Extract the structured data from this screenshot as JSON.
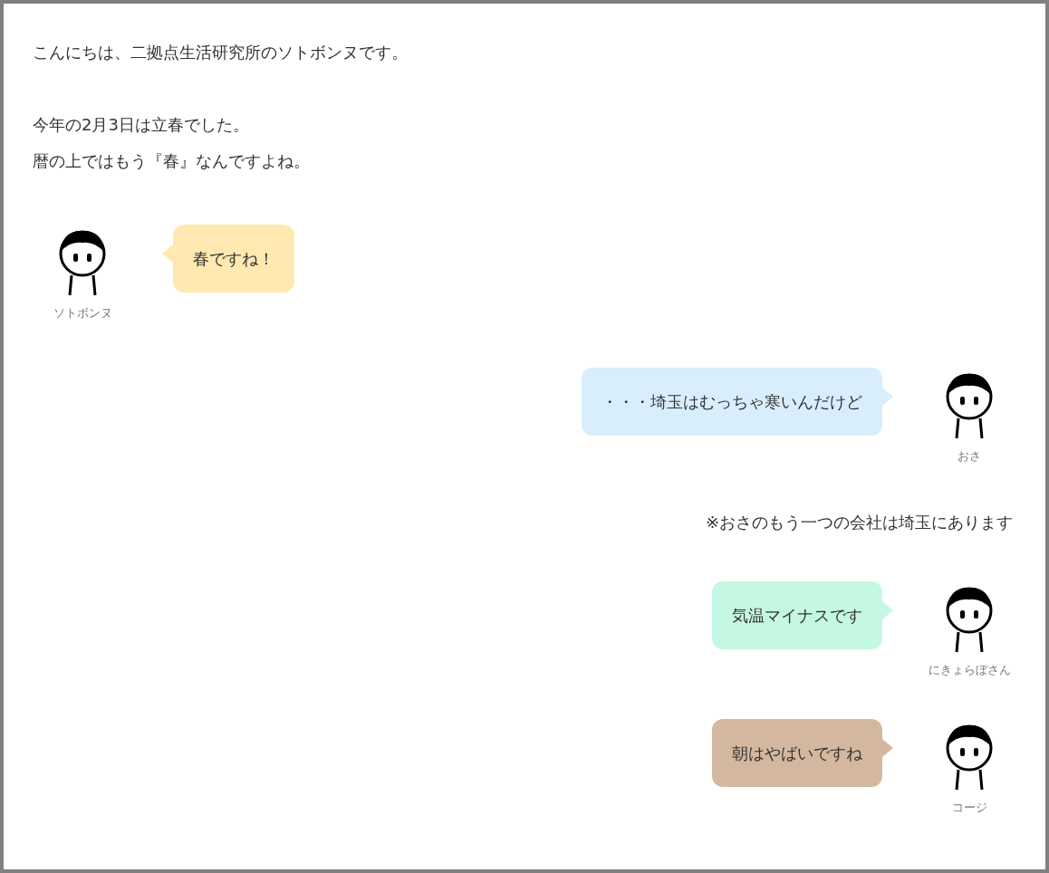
{
  "blocks": [
    {
      "kind": "paragraph",
      "lines": [
        "こんにちは、二拠点生活研究所のソトボンヌです。"
      ]
    },
    {
      "kind": "paragraph",
      "lines": [
        "今年の2月3日は立春でした。",
        "暦の上ではもう『春』なんですよね。"
      ]
    },
    {
      "kind": "chat_left",
      "name": "ソトボンヌ",
      "text": "春ですね！",
      "color": "#ffe9b0"
    },
    {
      "kind": "chat_right",
      "name": "おさ",
      "text": "・・・埼玉はむっちゃ寒いんだけど",
      "color": "#d9eefd"
    },
    {
      "kind": "note",
      "text": "※おさのもう一つの会社は埼玉にあります"
    },
    {
      "kind": "chat_right",
      "name": "にきょらぼさん",
      "text": "気温マイナスです",
      "color": "#c5f8e3"
    },
    {
      "kind": "chat_right",
      "name": "コージ",
      "text": "朝はやばいですね",
      "color": "#d3b89f"
    }
  ]
}
